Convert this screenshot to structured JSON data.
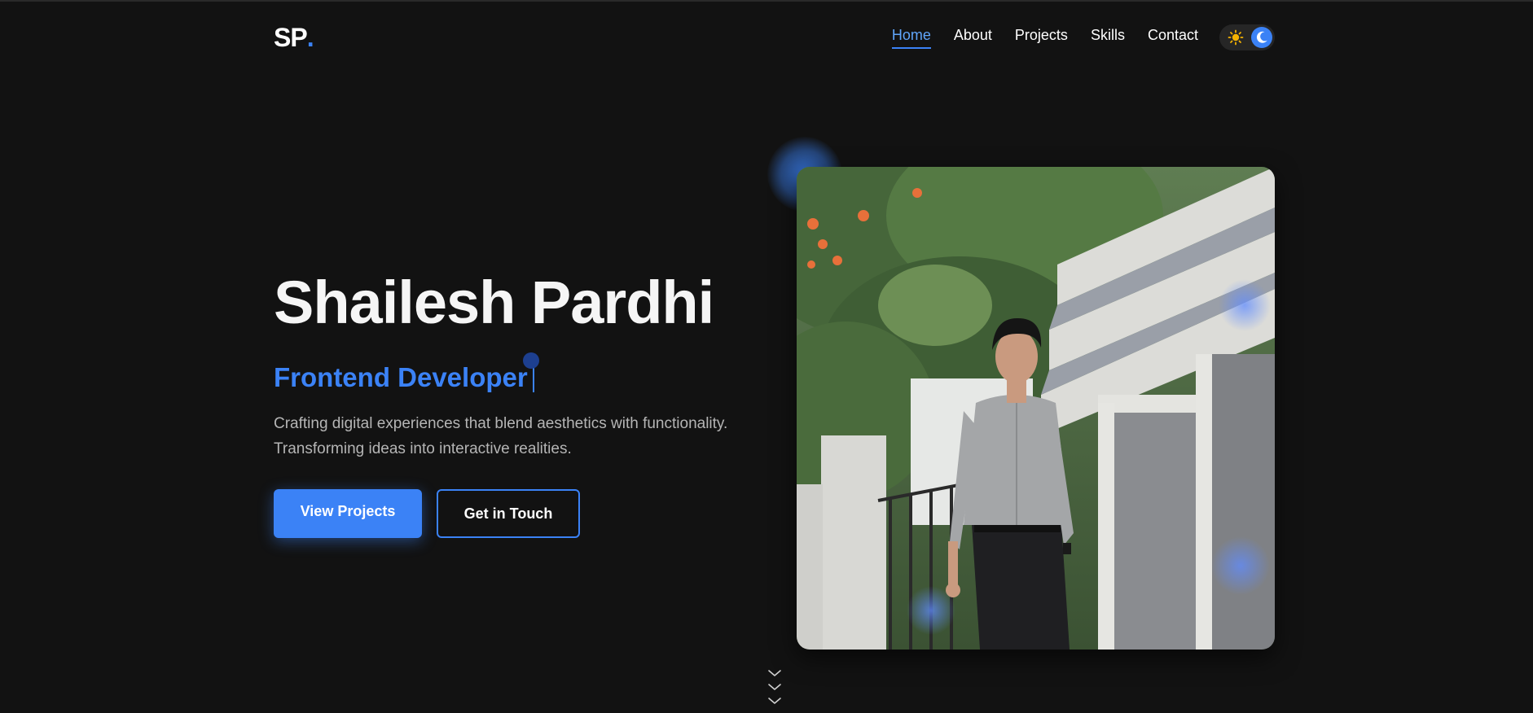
{
  "logo": {
    "text": "SP",
    "dot": "."
  },
  "nav": {
    "links": [
      {
        "label": "Home",
        "active": true
      },
      {
        "label": "About",
        "active": false
      },
      {
        "label": "Projects",
        "active": false
      },
      {
        "label": "Skills",
        "active": false
      },
      {
        "label": "Contact",
        "active": false
      }
    ],
    "theme_toggle": {
      "icons": [
        "sun-icon",
        "moon-icon"
      ],
      "mode": "dark"
    }
  },
  "hero": {
    "name": "Shailesh Pardhi",
    "role": "Frontend Developer",
    "description": "Crafting digital experiences that blend aesthetics with functionality. Transforming ideas into interactive realities.",
    "primary_button": "View Projects",
    "secondary_button": "Get in Touch"
  },
  "portrait": {
    "icon": "profile-photo"
  },
  "scroll": {
    "icon": "chevron-down-icon"
  },
  "colors": {
    "background": "#121212",
    "accent": "#3b82f6",
    "accent_light": "#60a5fa",
    "text": "#ffffff",
    "muted": "#b5b5b5"
  }
}
